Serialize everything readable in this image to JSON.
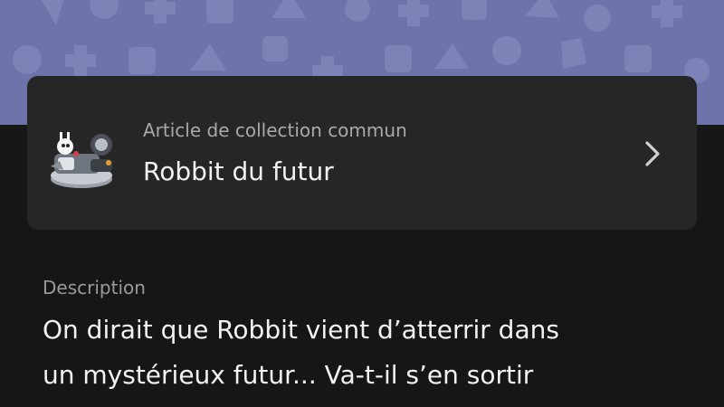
{
  "header": {
    "pattern_name": "playstation-shapes-pattern"
  },
  "item": {
    "type_label": "Article de collection commun",
    "name": "Robbit du futur",
    "thumbnail_icon": "robbit-figurine-thumbnail",
    "chevron_icon": "chevron-right-icon"
  },
  "description": {
    "label": "Description",
    "lines": [
      "On dirait que Robbit vient d’atterrir dans",
      "un mystérieux futur... Va-t-il s’en sortir"
    ]
  },
  "colors": {
    "banner": "#6c74aa",
    "background": "#161616",
    "card": "#262626",
    "primary_text": "#f2f2f2",
    "secondary_text": "#a9a9a9"
  }
}
